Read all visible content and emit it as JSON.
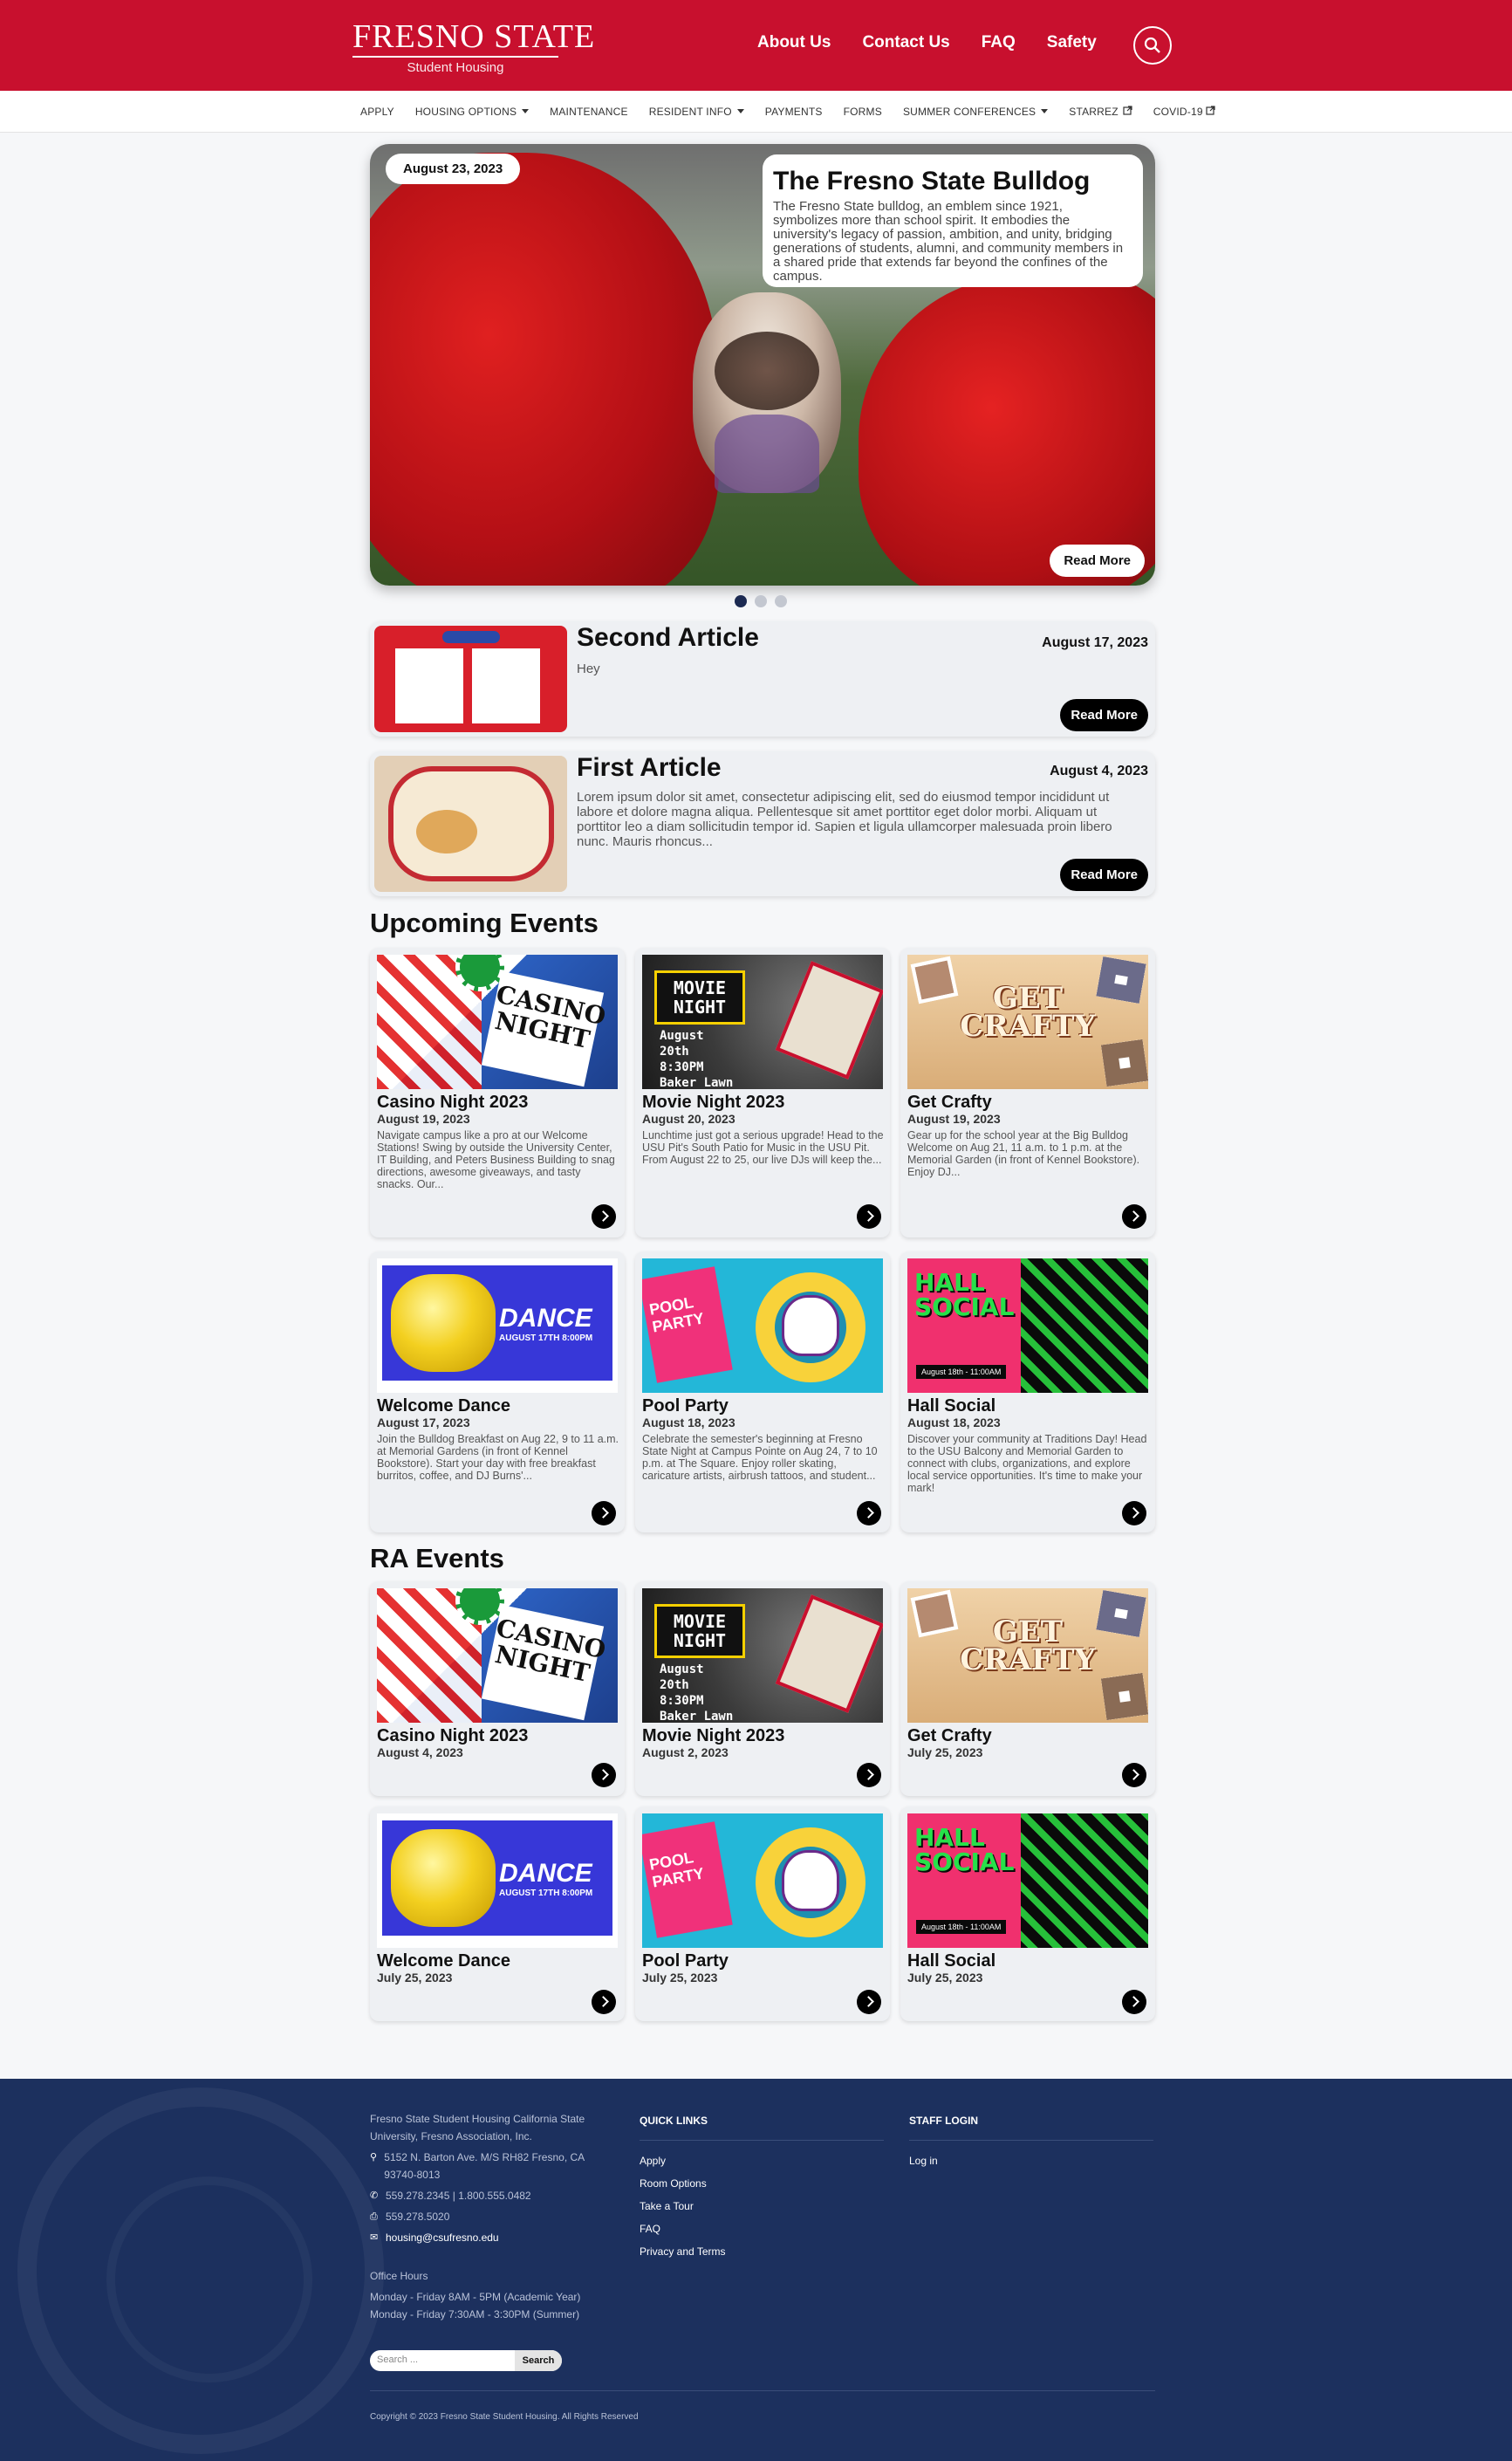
{
  "header": {
    "logo_main": "FRESNO STATE",
    "logo_sub": "Student Housing",
    "nav": [
      "About Us",
      "Contact Us",
      "FAQ",
      "Safety"
    ]
  },
  "subnav": {
    "items": [
      "APPLY",
      "HOUSING OPTIONS",
      "MAINTENANCE",
      "RESIDENT INFO",
      "PAYMENTS",
      "FORMS",
      "SUMMER CONFERENCES",
      "STARREZ",
      "COVID-19"
    ]
  },
  "hero": {
    "date": "August 23, 2023",
    "title": "The Fresno State Bulldog",
    "text": "The Fresno State bulldog, an emblem since 1921, symbolizes more than school spirit. It embodies the university's legacy of passion, ambition, and unity, bridging generations of students, alumni, and community members in a shared pride that extends far beyond the confines of the campus.",
    "read_more": "Read More",
    "slides": 3,
    "active_slide": 1
  },
  "articles": [
    {
      "title": "Second Article",
      "date": "August 17, 2023",
      "text": "Hey",
      "button": "Read More"
    },
    {
      "title": "First Article",
      "date": "August 4, 2023",
      "text": "Lorem ipsum dolor sit amet, consectetur adipiscing elit, sed do eiusmod tempor incididunt ut labore et dolore magna aliqua. Pellentesque sit amet porttitor eget dolor morbi. Aliquam ut porttitor leo a diam sollicitudin tempor id. Sapien et ligula ullamcorper malesuada proin libero nunc. Mauris rhoncus...",
      "button": "Read More"
    }
  ],
  "upcoming_title": "Upcoming Events",
  "upcoming": [
    {
      "title": "Casino Night 2023",
      "date": "August 19, 2023",
      "desc": "Navigate campus like a pro at our Welcome Stations! Swing by outside the University Center, IT Building, and Peters Business Building to snag directions, awesome giveaways, and tasty snacks. Our..."
    },
    {
      "title": "Movie Night 2023",
      "date": "August 20, 2023",
      "desc": "Lunchtime just got a serious upgrade! Head to the USU Pit's South Patio for Music in the USU Pit. From August 22 to 25, our live DJs will keep the..."
    },
    {
      "title": "Get Crafty",
      "date": "August 19, 2023",
      "desc": "Gear up for the school year at the Big Bulldog Welcome on Aug 21, 11 a.m. to 1 p.m. at the Memorial Garden (in front of Kennel Bookstore). Enjoy DJ..."
    },
    {
      "title": "Welcome Dance",
      "date": "August 17, 2023",
      "desc": "Join the Bulldog Breakfast on Aug 22, 9 to 11 a.m. at Memorial Gardens (in front of Kennel Bookstore). Start your day with free breakfast burritos, coffee, and DJ Burns'..."
    },
    {
      "title": "Pool Party",
      "date": "August 18, 2023",
      "desc": "Celebrate the semester's beginning at Fresno State Night at Campus Pointe on Aug 24, 7 to 10 p.m. at The Square. Enjoy roller skating, caricature artists, airbrush tattoos, and student..."
    },
    {
      "title": "Hall Social",
      "date": "August 18, 2023",
      "desc": "Discover your community at Traditions Day! Head to the USU Balcony and Memorial Garden to connect with clubs, organizations, and explore local service opportunities. It's time to make your mark!"
    }
  ],
  "ra_title": "RA Events",
  "ra": [
    {
      "title": "Casino Night 2023",
      "date": "August 4, 2023"
    },
    {
      "title": "Movie Night 2023",
      "date": "August 2, 2023"
    },
    {
      "title": "Get Crafty",
      "date": "July 25, 2023"
    },
    {
      "title": "Welcome Dance",
      "date": "July 25, 2023"
    },
    {
      "title": "Pool Party",
      "date": "July 25, 2023"
    },
    {
      "title": "Hall Social",
      "date": "July 25, 2023"
    }
  ],
  "art": {
    "casino": "CASINO NIGHT",
    "movie_top": "MOVIE NIGHT",
    "movie_sub": "August 20th 8:30PM Baker Lawn",
    "crafty": "GET CRAFTY",
    "dance": "DANCE",
    "dance_sub": "AUGUST 17TH 8:00PM",
    "pool": "POOL PARTY",
    "hall": "HALL SOCIAL",
    "hall_sub": "August 18th - 11:00AM"
  },
  "footer": {
    "org": "Fresno State Student Housing California State University, Fresno Association, Inc.",
    "address": "5152 N. Barton Ave. M/S RH82 Fresno, CA 93740-8013",
    "phone": "559.278.2345 | 1.800.555.0482",
    "fax": "559.278.5020",
    "email": "housing@csufresno.edu",
    "hours_title": "Office Hours",
    "hours1": "Monday - Friday 8AM - 5PM (Academic Year)",
    "hours2": "Monday - Friday 7:30AM - 3:30PM (Summer)",
    "quick_links_title": "QUICK LINKS",
    "quick_links": [
      "Apply",
      "Room Options",
      "Take a Tour",
      "FAQ",
      "Privacy and Terms"
    ],
    "staff_title": "STAFF LOGIN",
    "staff_link": "Log in",
    "search_placeholder": "Search ...",
    "search_button": "Search",
    "copyright": "Copyright © 2023 Fresno State Student Housing. All Rights Reserved"
  },
  "colors": {
    "brand_red": "#c8102e",
    "footer_navy": "#1c305e"
  }
}
